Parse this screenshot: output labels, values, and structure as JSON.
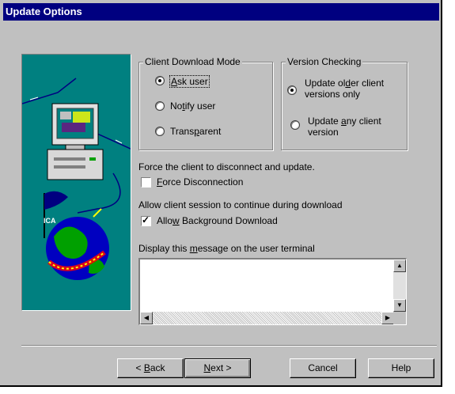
{
  "window": {
    "title": "Update Options"
  },
  "client_download_mode": {
    "legend": "Client Download Mode",
    "options": [
      {
        "label_pre": "",
        "label_u": "A",
        "label_post": "sk user",
        "selected": true
      },
      {
        "label_pre": "No",
        "label_u": "t",
        "label_post": "ify user",
        "selected": false
      },
      {
        "label_pre": "Trans",
        "label_u": "p",
        "label_post": "arent",
        "selected": false
      }
    ]
  },
  "version_checking": {
    "legend": "Version Checking",
    "options": [
      {
        "line1_pre": "Update ol",
        "line1_u": "d",
        "line1_post": "er client",
        "line2": "versions only",
        "selected": true
      },
      {
        "line1_pre": "Update ",
        "line1_u": "a",
        "line1_post": "ny client",
        "line2": "version",
        "selected": false
      }
    ]
  },
  "force": {
    "description": "Force the client to disconnect and update.",
    "checkbox_u": "F",
    "checkbox_post": "orce Disconnection",
    "checked": false
  },
  "background": {
    "description": "Allow client session to continue during download",
    "checkbox_pre": "Allo",
    "checkbox_u": "w",
    "checkbox_post": " Background Download",
    "checked": true
  },
  "message": {
    "label_pre": "Display this ",
    "label_u": "m",
    "label_post": "essage on the user terminal",
    "value": ""
  },
  "illustration": {
    "badge": "ICA"
  },
  "buttons": {
    "back_pre": "< ",
    "back_u": "B",
    "back_post": "ack",
    "next_u": "N",
    "next_post": "ext >",
    "cancel": "Cancel",
    "help": "Help"
  },
  "scroll": {
    "up": "▲",
    "down": "▼",
    "left": "◀",
    "right": "▶"
  }
}
